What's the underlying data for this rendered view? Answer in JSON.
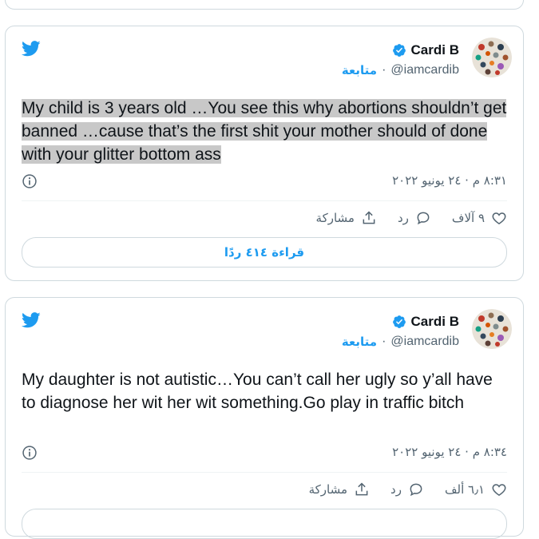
{
  "tweets": [
    {
      "name": "Cardi B",
      "handle": "@iamcardib",
      "follow_label": "متابعة",
      "separator": "·",
      "text": "My child is 3 years old …You see this why abortions shouldn’t get banned …cause that’s the first shit your mother should of done with your glitter bottom ass",
      "text_highlighted": true,
      "time": "٨:٣١ م · ٢٤ يونيو ٢٠٢٢",
      "likes": "٩ آلاف",
      "reply_label": "رد",
      "share_label": "مشاركة",
      "read_replies": "قراءة ٤١٤ ردًا"
    },
    {
      "name": "Cardi B",
      "handle": "@iamcardib",
      "follow_label": "متابعة",
      "separator": "·",
      "text": "My daughter is not autistic…You can’t call her ugly so y’all have to diagnose her wit her wit something.Go play in traffic bitch",
      "text_highlighted": false,
      "time": "٨:٣٤ م · ٢٤ يونيو ٢٠٢٢",
      "likes": "٦٫١ ألف",
      "reply_label": "رد",
      "share_label": "مشاركة"
    }
  ],
  "colors": {
    "twitter_blue": "#1d9bf0",
    "text": "#0f1419",
    "muted": "#536471",
    "border": "#cfd9de",
    "highlight": "#c8c8c8"
  },
  "icons": [
    "twitter-bird-icon",
    "verified-badge-icon",
    "info-icon",
    "heart-icon",
    "reply-bubble-icon",
    "share-icon"
  ]
}
